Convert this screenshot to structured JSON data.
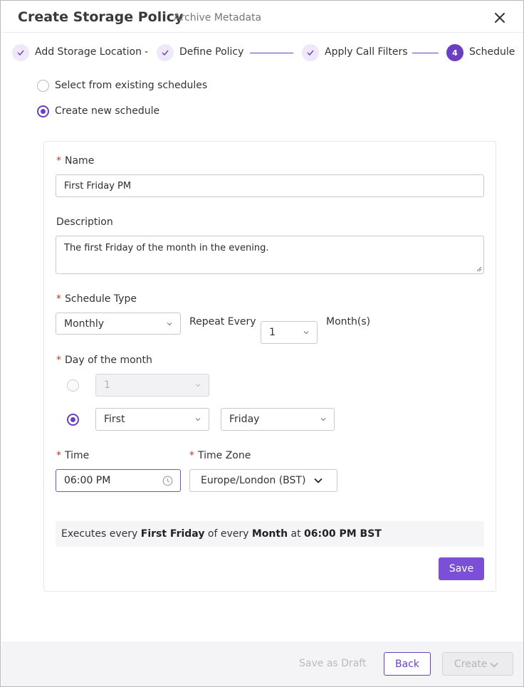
{
  "header": {
    "title": "Create Storage Policy",
    "subtitle": "Archive Metadata"
  },
  "stepper": {
    "steps": [
      {
        "label": "Add Storage Location",
        "state": "done"
      },
      {
        "label": "Define Policy",
        "state": "done"
      },
      {
        "label": "Apply Call Filters",
        "state": "done"
      },
      {
        "label": "Schedule",
        "state": "active",
        "number": "4"
      }
    ],
    "separator": "-"
  },
  "schedule_mode": {
    "existing_label": "Select from existing schedules",
    "new_label": "Create new schedule",
    "selected": "new"
  },
  "form": {
    "name_label": "Name",
    "name_value": "First Friday PM",
    "description_label": "Description",
    "description_value": "The first Friday of the month in the evening.",
    "schedule_type_label": "Schedule Type",
    "schedule_type_value": "Monthly",
    "repeat_every_label": "Repeat Every",
    "repeat_every_value": "1",
    "repeat_unit": "Month(s)",
    "day_of_month_label": "Day of the month",
    "day_number_value": "1",
    "ordinal_value": "First",
    "weekday_value": "Friday",
    "time_label": "Time",
    "time_value": "06:00 PM",
    "timezone_label": "Time Zone",
    "timezone_value": "Europe/London (BST)",
    "required_marker": "*"
  },
  "summary": {
    "prefix": "Executes every",
    "occurrence": "First Friday",
    "of_every": "of every",
    "period": "Month",
    "at": "at",
    "time": "06:00 PM BST"
  },
  "save_label": "Save",
  "footer": {
    "save_draft_label": "Save as Draft",
    "back_label": "Back",
    "create_label": "Create"
  },
  "colors": {
    "accent": "#6b3fc2",
    "primary_button": "#7b4fd6",
    "required": "#c0392b"
  }
}
